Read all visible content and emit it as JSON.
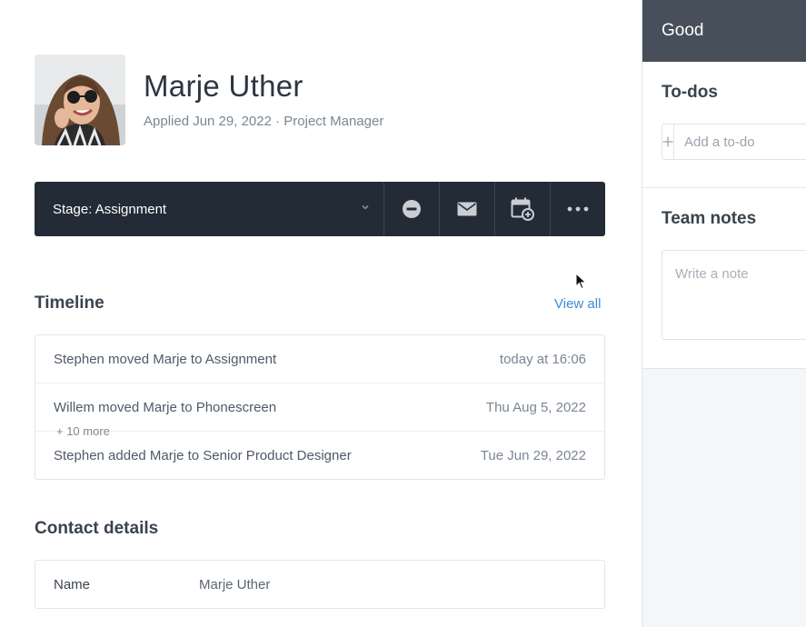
{
  "candidate": {
    "name": "Marje Uther",
    "applied": "Applied Jun 29, 2022 · Project Manager"
  },
  "stage_bar": {
    "stage_label": "Stage: Assignment",
    "actions": [
      "disqualify-icon",
      "email-icon",
      "schedule-icon",
      "more-icon"
    ]
  },
  "timeline": {
    "title": "Timeline",
    "view_all": "View all",
    "events": [
      {
        "text": "Stephen moved Marje to Assignment",
        "date": "today at 16:06"
      },
      {
        "text": "Willem moved Marje to Phonescreen",
        "date": "Thu Aug 5, 2022"
      },
      {
        "text": "Stephen added Marje to Senior Product Designer",
        "date": "Tue Jun 29, 2022"
      }
    ],
    "more": "+ 10 more"
  },
  "contact": {
    "title": "Contact details",
    "name_label": "Name",
    "name_value": "Marje Uther"
  },
  "sidebar": {
    "header": "Good",
    "todos_title": "To-dos",
    "todo_placeholder": "Add a to-do",
    "notes_title": "Team notes",
    "note_placeholder": "Write a note"
  },
  "colors": {
    "stage_bar_bg": "#222b36",
    "sidebar_header_bg": "#474f5a",
    "link": "#3d8bd8"
  }
}
